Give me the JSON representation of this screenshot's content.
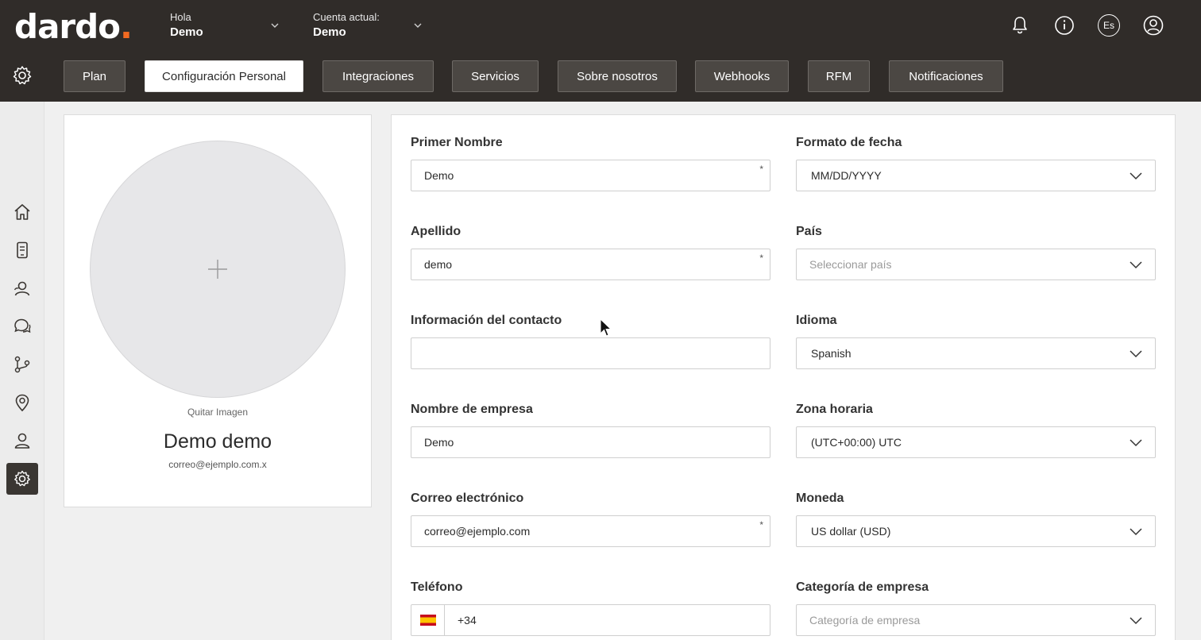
{
  "header": {
    "logo_text": "dardo",
    "greeting_label": "Hola",
    "greeting_name": "Demo",
    "account_label": "Cuenta actual:",
    "account_name": "Demo",
    "language_badge": "Es"
  },
  "tabs": [
    {
      "label": "Plan"
    },
    {
      "label": "Configuración Personal",
      "active": true
    },
    {
      "label": "Integraciones"
    },
    {
      "label": "Servicios"
    },
    {
      "label": "Sobre nosotros"
    },
    {
      "label": "Webhooks"
    },
    {
      "label": "RFM"
    },
    {
      "label": "Notificaciones"
    }
  ],
  "sidebar": {
    "items": [
      {
        "icon": "home-icon"
      },
      {
        "icon": "phone-device-icon"
      },
      {
        "icon": "contacts-icon"
      },
      {
        "icon": "chat-icon"
      },
      {
        "icon": "flow-icon"
      },
      {
        "icon": "location-icon"
      },
      {
        "icon": "user-icon"
      },
      {
        "icon": "gear-icon",
        "active": true
      }
    ]
  },
  "profile": {
    "remove_image": "Quitar Imagen",
    "name": "Demo demo",
    "email": "correo@ejemplo.com.x"
  },
  "form": {
    "first_name": {
      "label": "Primer Nombre",
      "value": "Demo",
      "required": "*"
    },
    "last_name": {
      "label": "Apellido",
      "value": "demo",
      "required": "*"
    },
    "contact_info": {
      "label": "Información del contacto",
      "value": ""
    },
    "company_name": {
      "label": "Nombre de empresa",
      "value": "Demo"
    },
    "email": {
      "label": "Correo electrónico",
      "value": "correo@ejemplo.com",
      "required": "*"
    },
    "phone": {
      "label": "Teléfono",
      "code": "+34"
    },
    "date_format": {
      "label": "Formato de fecha",
      "value": "MM/DD/YYYY"
    },
    "country": {
      "label": "País",
      "placeholder": "Seleccionar país"
    },
    "language": {
      "label": "Idioma",
      "value": "Spanish"
    },
    "timezone": {
      "label": "Zona horaria",
      "value": "(UTC+00:00) UTC"
    },
    "currency": {
      "label": "Moneda",
      "value": "US dollar (USD)"
    },
    "company_category": {
      "label": "Categoría de empresa",
      "placeholder": "Categoría de empresa"
    }
  },
  "colors": {
    "topbar": "#302c29",
    "accent": "#f26a21"
  }
}
